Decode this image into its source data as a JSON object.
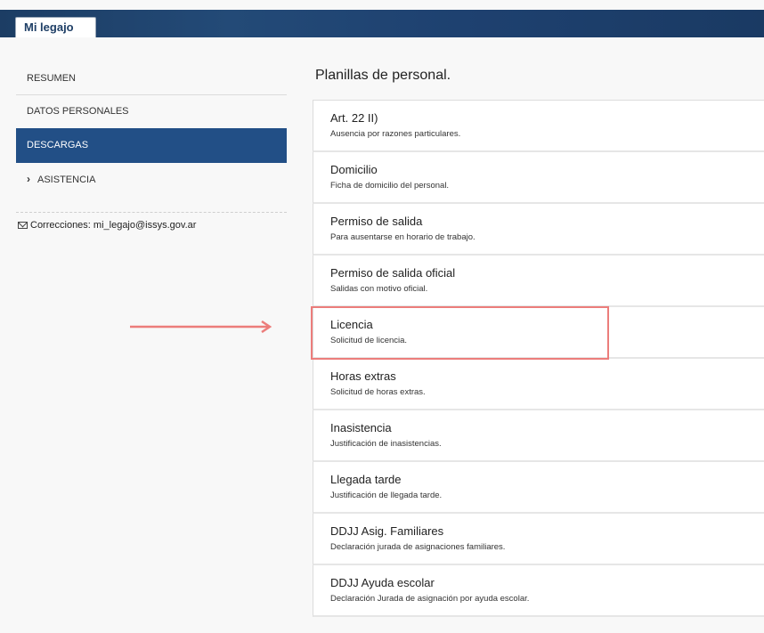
{
  "header": {
    "tab_label": "Mi legajo"
  },
  "sidebar": {
    "items": [
      {
        "label": "RESUMEN"
      },
      {
        "label": "DATOS PERSONALES"
      },
      {
        "label": "DESCARGAS"
      },
      {
        "label": "ASISTENCIA"
      }
    ],
    "contact": "Correcciones: mi_legajo@issys.gov.ar"
  },
  "main": {
    "title": "Planillas de personal.",
    "items": [
      {
        "title": "Art. 22 II)",
        "desc": "Ausencia por razones particulares."
      },
      {
        "title": "Domicilio",
        "desc": "Ficha de domicilio del personal."
      },
      {
        "title": "Permiso de salida",
        "desc": "Para ausentarse en horario de trabajo."
      },
      {
        "title": "Permiso de salida oficial",
        "desc": "Salidas con motivo oficial."
      },
      {
        "title": "Licencia",
        "desc": "Solicitud de licencia."
      },
      {
        "title": "Horas extras",
        "desc": "Solicitud de horas extras."
      },
      {
        "title": "Inasistencia",
        "desc": "Justificación de inasistencias."
      },
      {
        "title": "Llegada tarde",
        "desc": "Justificación de llegada tarde."
      },
      {
        "title": "DDJJ Asig. Familiares",
        "desc": "Declaración jurada de asignaciones familiares."
      },
      {
        "title": "DDJJ Ayuda escolar",
        "desc": "Declaración Jurada de asignación por ayuda escolar."
      }
    ]
  },
  "colors": {
    "accent": "#224f86",
    "highlight": "#ec7d7b"
  }
}
